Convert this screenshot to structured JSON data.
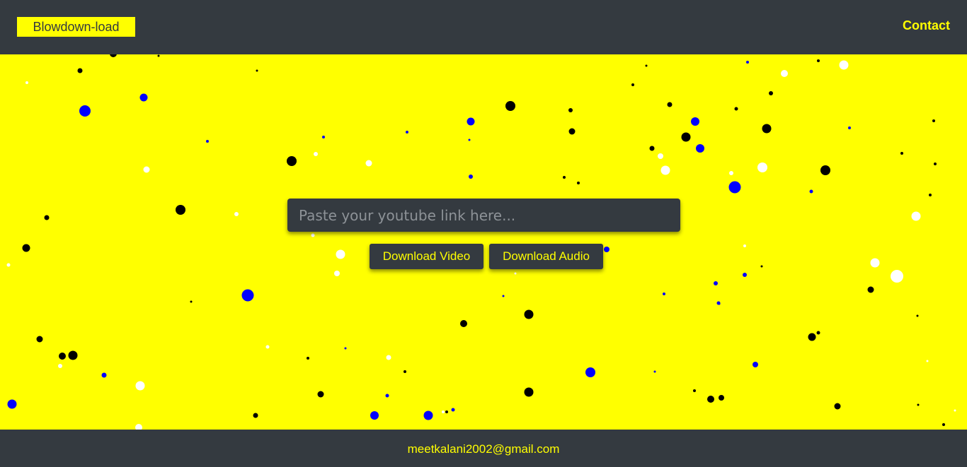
{
  "header": {
    "logo_text": "Blowdown-load",
    "contact_label": "Contact"
  },
  "main": {
    "search_placeholder": "Paste your youtube link here...",
    "download_video_label": "Download Video",
    "download_audio_label": "Download Audio"
  },
  "footer": {
    "email": "meetkalani2002@gmail.com"
  },
  "colors": {
    "accent": "#ffff00",
    "dark": "#343a40",
    "particle_black": "#000000",
    "particle_blue": "#0000ff",
    "particle_white": "#ffffff"
  }
}
